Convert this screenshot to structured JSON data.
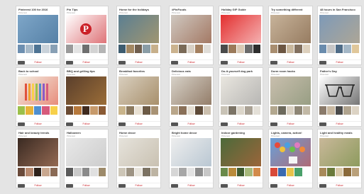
{
  "board_owner": "Pinterest",
  "edit_label": "Follow",
  "boards": [
    {
      "title": "Pinterest 100 for 2016",
      "cover": "#7ea6c8",
      "accent": "#3d6a92",
      "thumbs": [
        "#6d8fb0",
        "#a7b9c8",
        "#4d7393",
        "#c9d2da",
        "#88a0b5"
      ]
    },
    {
      "title": "Pin Tips",
      "cover": "#ffffff",
      "accent": "#cb2027",
      "thumbs": [
        "#9a9a9a",
        "#e3e3e3",
        "#6f6f6f",
        "#d3d3d3",
        "#b5b5b5"
      ],
      "logo": true
    },
    {
      "title": "Home for the holidays",
      "cover": "#5b7f92",
      "accent": "#c9a35d",
      "thumbs": [
        "#3d5c6f",
        "#a38863",
        "#6f5e4e",
        "#8a9da6",
        "#c7b08b"
      ]
    },
    {
      "title": "#PinFoods",
      "cover": "#cfc8c0",
      "accent": "#8a4a2e",
      "thumbs": [
        "#cbb38f",
        "#7a6a57",
        "#d9d1c6",
        "#a48060",
        "#e0ddd8"
      ]
    },
    {
      "title": "Holiday GIF Guide",
      "cover": "#e32f2f",
      "accent": "#ffffff",
      "thumbs": [
        "#4a4a4a",
        "#9b7a5a",
        "#d9c9b5",
        "#6a6a6a",
        "#2d2d2d"
      ]
    },
    {
      "title": "Try something different",
      "cover": "#c7b39a",
      "accent": "#7a5b3f",
      "thumbs": [
        "#a98e70",
        "#6c5642",
        "#c9b89e",
        "#82705f",
        "#ddd0bd"
      ]
    },
    {
      "title": "48 hours in San Francisco",
      "cover": "#7e9ab8",
      "accent": "#c9ad82",
      "thumbs": [
        "#6a8cad",
        "#c7c7c7",
        "#4f6c87",
        "#a4b7c6",
        "#e0c79a"
      ]
    },
    {
      "title": "Back to school",
      "cover": "#f3efe4",
      "accent": "#e0513c",
      "thumbs": [
        "#9cc04a",
        "#e8b33a",
        "#4f8fcf",
        "#d65a7c",
        "#f7d04a"
      ],
      "pencils": true
    },
    {
      "title": "BBQ and grilling tips",
      "cover": "#5a3f2c",
      "accent": "#c2893f",
      "thumbs": [
        "#6a4a32",
        "#b7793c",
        "#3f2a1e",
        "#c79a6b",
        "#8a5a34"
      ]
    },
    {
      "title": "Breakfast favorites",
      "cover": "#d9cfbf",
      "accent": "#8a6a3a",
      "thumbs": [
        "#c9b48b",
        "#8c7a5f",
        "#e8e0d2",
        "#6c5a45",
        "#a89274"
      ]
    },
    {
      "title": "Delicious eats",
      "cover": "#d7d2c9",
      "accent": "#6b4a2f",
      "thumbs": [
        "#b9a68a",
        "#8a7058",
        "#e4ddd1",
        "#5e4a38",
        "#cbbfae"
      ]
    },
    {
      "title": "Do-it-yourself dog park",
      "cover": "#e9e6df",
      "accent": "#9a9a9a",
      "thumbs": [
        "#c9c3b6",
        "#7c7466",
        "#dcd6ca",
        "#aaa295",
        "#e4e0d8"
      ]
    },
    {
      "title": "Dorm room hacks",
      "cover": "#c9bfae",
      "accent": "#7a8a6a",
      "thumbs": [
        "#b3a88f",
        "#6d6a5c",
        "#d9d1c2",
        "#8e8675",
        "#c2b9a6"
      ]
    },
    {
      "title": "Father's Day",
      "cover": "#ffffff",
      "accent": "#222222",
      "thumbs": [
        "#8a7a6a",
        "#c9b9a2",
        "#4a4a4a",
        "#b0a48f",
        "#dcd3c4"
      ],
      "dad": true
    },
    {
      "title": "Hair and beauty trends",
      "cover": "#3a2a22",
      "accent": "#c98f70",
      "thumbs": [
        "#6a4a3a",
        "#b88a70",
        "#2e221b",
        "#c9a890",
        "#8a6a55"
      ]
    },
    {
      "title": "Halloween",
      "cover": "#e8e8e8",
      "accent": "#bdbdbd",
      "thumbs": [
        "#5a5a5a",
        "#c9c9c9",
        "#8a8a8a",
        "#e0e0e0",
        "#9d8a6a"
      ]
    },
    {
      "title": "Home decor",
      "cover": "#e6e3dc",
      "accent": "#b8ad98",
      "thumbs": [
        "#cdc6b7",
        "#9d9383",
        "#e8e4dc",
        "#7c7262",
        "#bdb4a3"
      ]
    },
    {
      "title": "Bright home decor",
      "cover": "#eeeeee",
      "accent": "#9ab0c2",
      "thumbs": [
        "#d6d6d6",
        "#a7a7a7",
        "#e3e3e3",
        "#8c8c8c",
        "#c7c7c7"
      ]
    },
    {
      "title": "Indoor gardening",
      "cover": "#4c6a3a",
      "accent": "#c9623a",
      "thumbs": [
        "#6a8a4a",
        "#b98a3a",
        "#3f5a2f",
        "#a6b87a",
        "#d28a4a"
      ]
    },
    {
      "title": "Lights, camera, action!",
      "cover": "#6aa0d8",
      "accent": "#d84a3a",
      "thumbs": [
        "#d84a3a",
        "#3a6ab0",
        "#e8c34a",
        "#4aa06a",
        "#ffffff"
      ],
      "up": true
    },
    {
      "title": "Light and healthy meals",
      "cover": "#c9b89a",
      "accent": "#6a8a3a",
      "thumbs": [
        "#a88a5a",
        "#6a7a3a",
        "#d9c9a8",
        "#8a6a3a",
        "#b9a07a"
      ]
    }
  ]
}
